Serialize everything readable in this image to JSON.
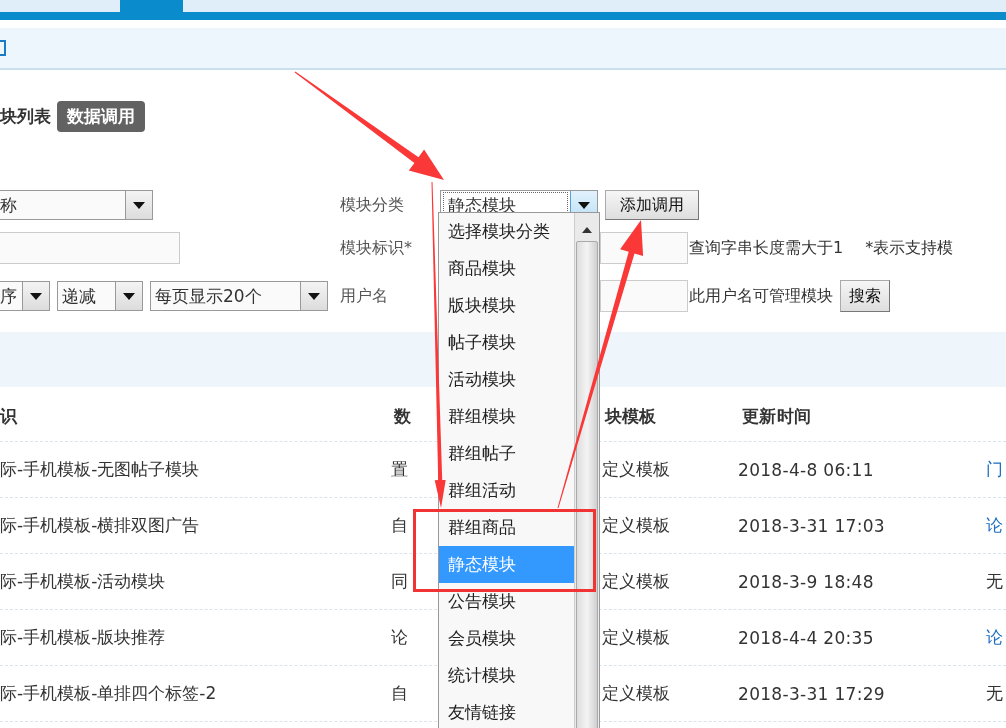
{
  "heading": {
    "title": "块列表",
    "badge": "数据调用"
  },
  "filters": {
    "name_select": "称",
    "sort_field": "序",
    "sort_order": "递减",
    "page_size": "每页显示20个"
  },
  "module_category": {
    "label": "模块分类",
    "value": "静态模块",
    "expanded": true,
    "options": [
      {
        "label": "选择模块分类",
        "selected": false
      },
      {
        "label": "商品模块",
        "selected": false
      },
      {
        "label": "版块模块",
        "selected": false
      },
      {
        "label": "帖子模块",
        "selected": false
      },
      {
        "label": "活动模块",
        "selected": false
      },
      {
        "label": "群组模块",
        "selected": false
      },
      {
        "label": "群组帖子",
        "selected": false
      },
      {
        "label": "群组活动",
        "selected": false
      },
      {
        "label": "群组商品",
        "selected": false
      },
      {
        "label": "静态模块",
        "selected": true
      },
      {
        "label": "公告模块",
        "selected": false
      },
      {
        "label": "会员模块",
        "selected": false
      },
      {
        "label": "统计模块",
        "selected": false
      },
      {
        "label": "友情链接",
        "selected": false
      }
    ]
  },
  "add_button": "添加调用",
  "module_id": {
    "label": "模块标识*",
    "hint": "查询字串长度需大于1",
    "note": "*表示支持模"
  },
  "username": {
    "label": "用户名",
    "hint": "此用户名可管理模块"
  },
  "search_button": "搜索",
  "table": {
    "columns": [
      "识",
      "数",
      "块模板",
      "更新时间"
    ],
    "rows": [
      {
        "column_1": "际-手机模板-无图帖子模块",
        "column_2": "置",
        "column_3": "定义模板",
        "column_4": "2018-4-8 06:11",
        "column_5": {
          "text": "门",
          "kind": "link"
        }
      },
      {
        "column_1": "际-手机模板-横排双图广告",
        "column_2": "自",
        "column_3": "定义模板",
        "column_4": "2018-3-31 17:03",
        "column_5": {
          "text": "论",
          "kind": "link"
        }
      },
      {
        "column_1": "际-手机模板-活动模块",
        "column_2": "同",
        "column_3": "定义模板",
        "column_4": "2018-3-9 18:48",
        "column_5": {
          "text": "无",
          "kind": "text"
        }
      },
      {
        "column_1": "际-手机模板-版块推荐",
        "column_2": "论",
        "column_3": "定义模板",
        "column_4": "2018-4-4 20:35",
        "column_5": {
          "text": "论",
          "kind": "link"
        }
      },
      {
        "column_1": "际-手机模板-单排四个标签-2",
        "column_2": "自",
        "column_3": "定义模板",
        "column_4": "2018-3-31 17:29",
        "column_5": {
          "text": "无",
          "kind": "text"
        }
      }
    ]
  },
  "annotations": [
    {
      "kind": "arrow"
    },
    {
      "kind": "arrow"
    },
    {
      "kind": "arrow"
    },
    {
      "kind": "highlight_box"
    }
  ]
}
